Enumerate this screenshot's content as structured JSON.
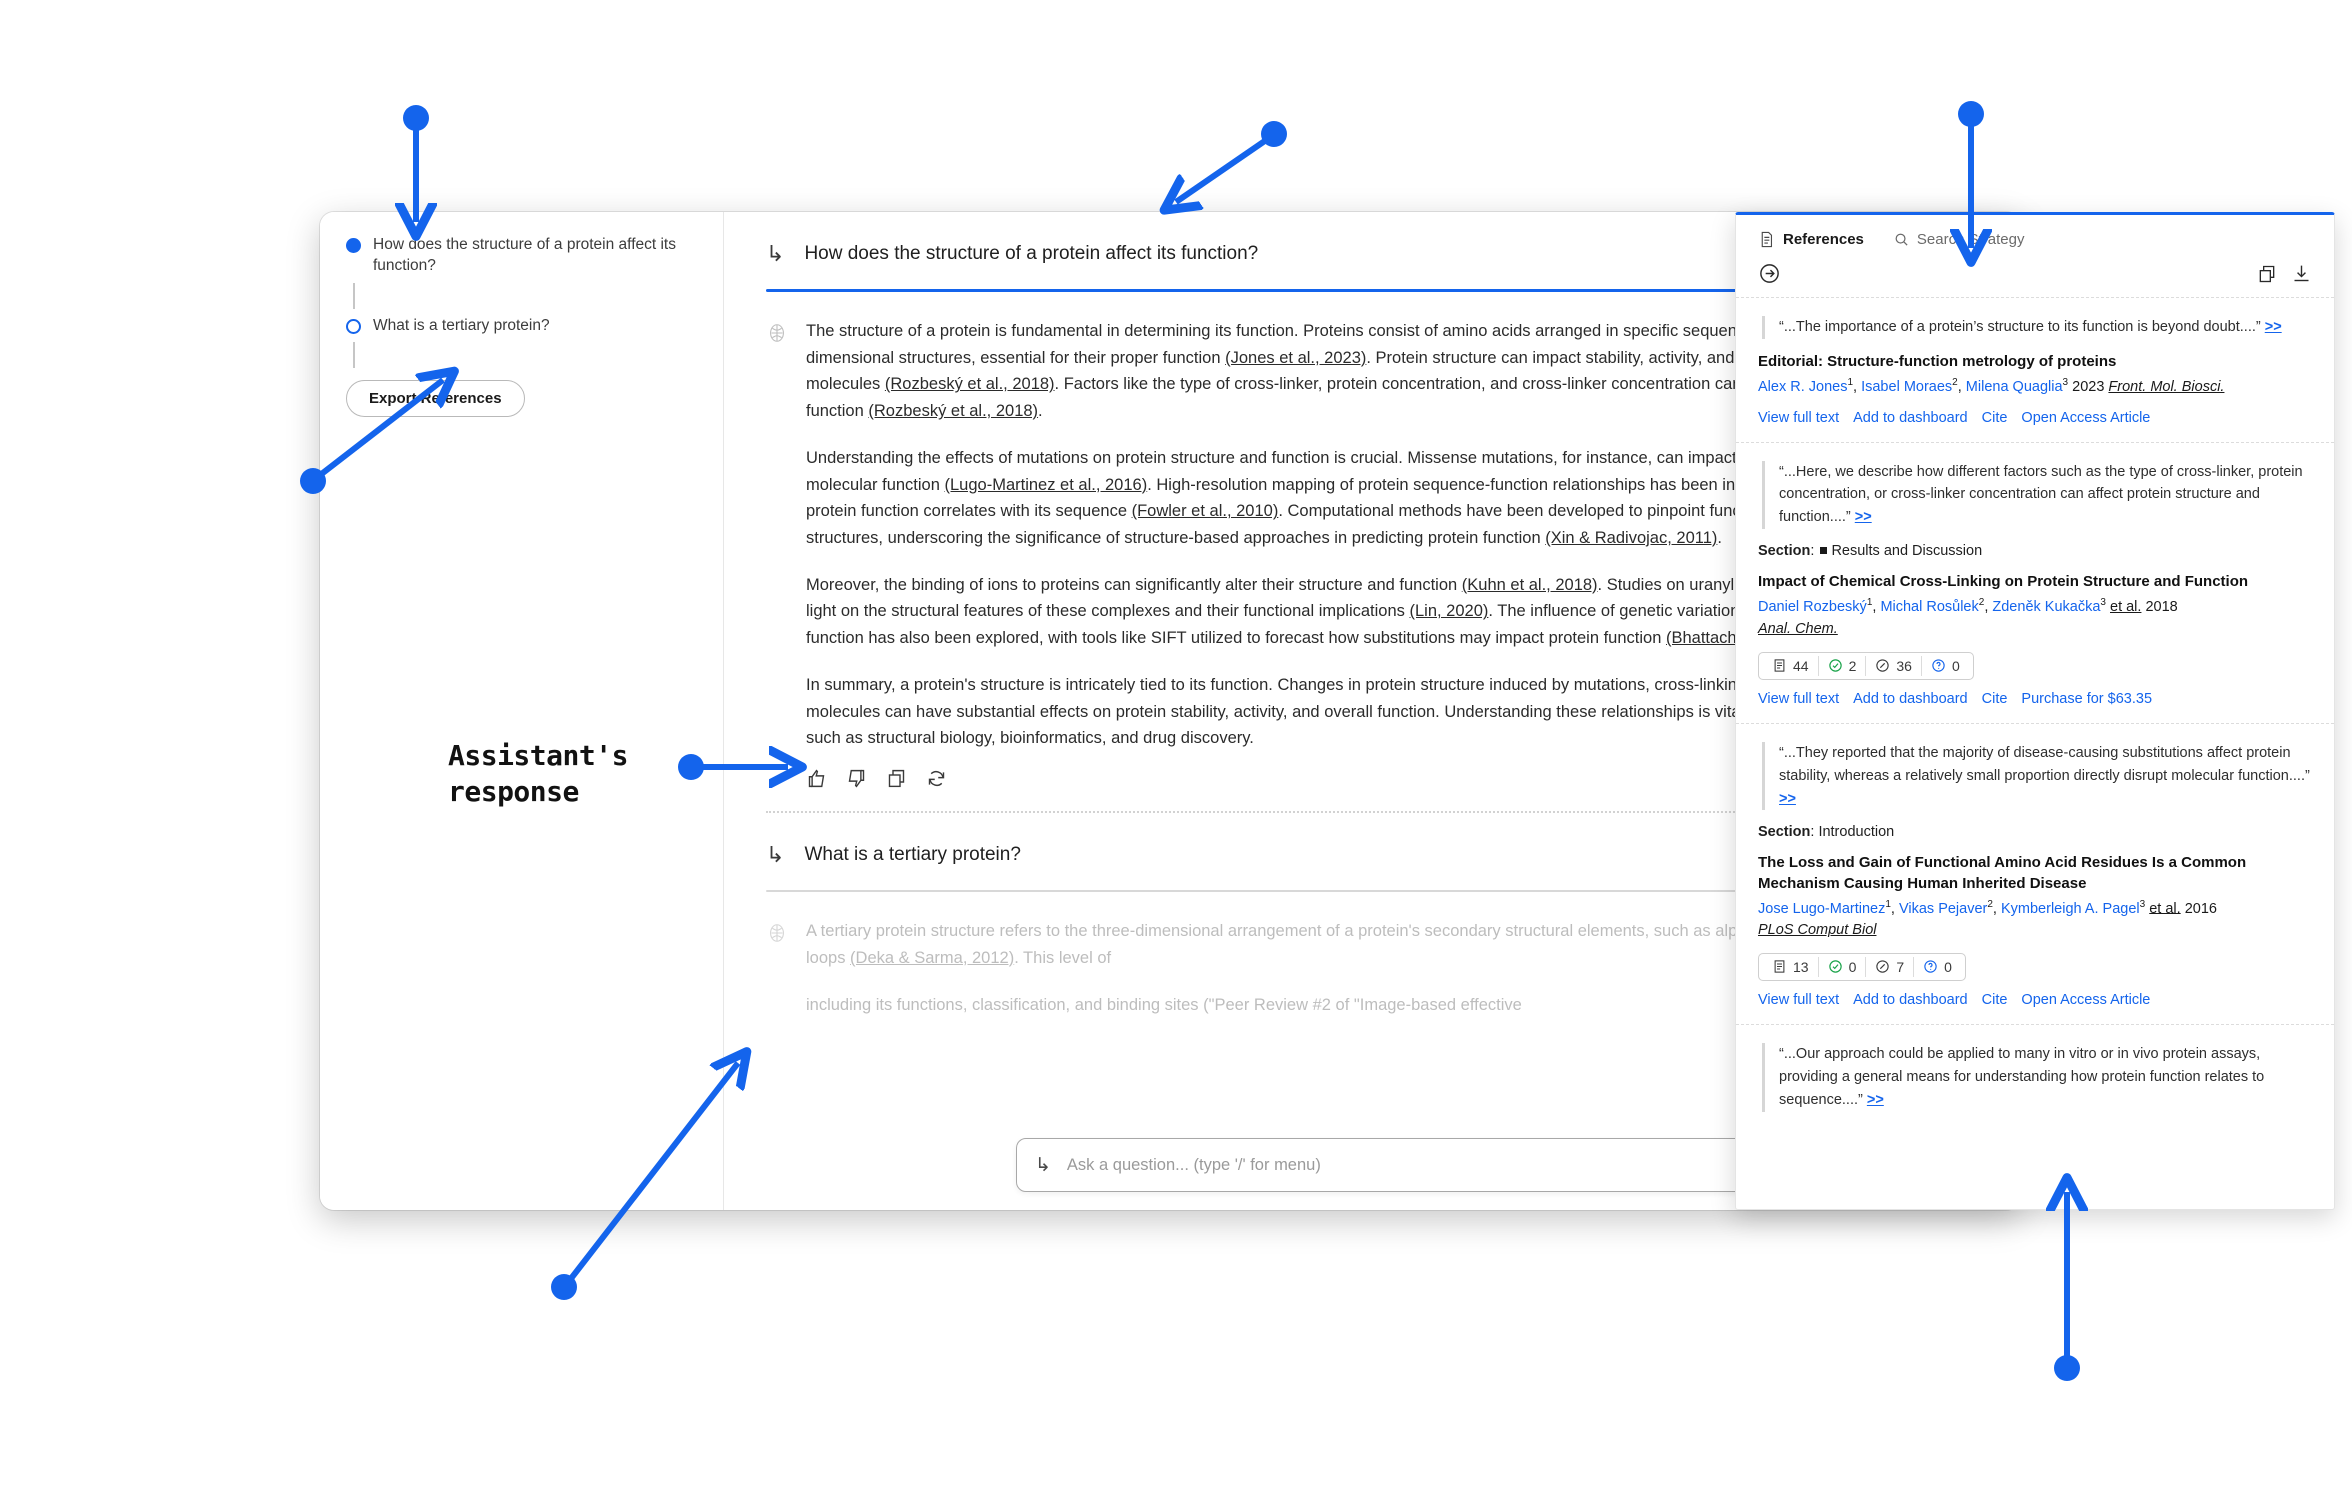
{
  "sidebar": {
    "outline": [
      {
        "label": "How does the structure of a protein affect its function?",
        "state": "active"
      },
      {
        "label": "What is a tertiary protein?",
        "state": "inactive"
      }
    ],
    "export_button": "Export References"
  },
  "conversation": {
    "turns": [
      {
        "question": "How does the structure of a protein affect its function?",
        "paragraphs": [
          "The structure of a protein is fundamental in determining its function. Proteins consist of amino acids arranged in specific sequences that fold into intricate three-dimensional structures, essential for their proper function (Jones et al., 2023). Protein structure can impact stability, activity, and interactions with other molecules (Rozbeský et al., 2018). Factors like the type of cross-linker, protein concentration, and cross-linker concentration can influence protein structure and function (Rozbeský et al., 2018).",
          "Understanding the effects of mutations on protein structure and function is crucial. Missense mutations, for instance, can impact protein stability and disrupt molecular function (Lugo-Martinez et al., 2016). High-resolution mapping of protein sequence-function relationships has been instrumental in revealing how protein function correlates with its sequence (Fowler et al., 2010). Computational methods have been developed to pinpoint functional residues in protein structures, underscoring the significance of structure-based approaches in predicting protein function (Xin & Radivojac, 2011).",
          "Moreover, the binding of ions to proteins can significantly alter their structure and function (Kuhn et al., 2018). Studies on uranyl-protein interactions have shed light on the structural features of these complexes and their functional implications (Lin, 2020). The influence of genetic variation on protein structure and function has also been explored, with tools like SIFT utilized to forecast how substitutions may impact protein function (Bhattacharya et al., 2017).",
          "In summary, a protein's structure is intricately tied to its function. Changes in protein structure induced by mutations, cross-linking, or interactions with other molecules can have substantial effects on protein stability, activity, and overall function. Understanding these relationships is vital for the advancement of fields such as structural biology, bioinformatics, and drug discovery."
        ],
        "feedback_icons": [
          "thumbs-up-icon",
          "thumbs-down-icon",
          "copy-icon",
          "regenerate-icon"
        ]
      },
      {
        "question": "What is a tertiary protein?",
        "paragraphs": [
          "A tertiary protein structure refers to the three-dimensional arrangement of a protein's secondary structural elements, such as alpha-helices, beta-sheets, and loops (Deka & Sarma, 2012). This level of",
          "including its functions, classification, and binding sites (\"Peer Review #2 of \"Image-based effective"
        ]
      }
    ]
  },
  "ask": {
    "placeholder": "Ask a question... (type '/' for menu)",
    "value": "",
    "send_icon": "send-icon"
  },
  "references_panel": {
    "tabs": [
      {
        "label": "References",
        "icon": "document-icon",
        "active": true
      },
      {
        "label": "Search Strategy",
        "icon": "search-icon",
        "active": false
      }
    ],
    "toolbar": {
      "expand_icon": "arrow-right-circle-icon",
      "copy_icon": "copy-icon",
      "download_icon": "download-icon"
    },
    "items": [
      {
        "quote": "“...The importance of a protein’s structure to its function is beyond doubt....”",
        "more": ">>",
        "section_label": "",
        "section_value": "",
        "title": "Editorial: Structure-function metrology of proteins",
        "authors": [
          {
            "name": "Alex R. Jones",
            "sup": "1"
          },
          {
            "name": "Isabel Moraes",
            "sup": "2"
          },
          {
            "name": "Milena Quaglia",
            "sup": "3"
          }
        ],
        "etal": "",
        "year": "2023",
        "journal": "Front. Mol. Biosci.",
        "metrics": [],
        "actions": [
          "View full text",
          "Add to dashboard",
          "Cite",
          "Open Access Article"
        ]
      },
      {
        "quote": "“...Here, we describe how different factors such as the type of cross-linker, protein concentration, or cross-linker concentration can affect protein structure and function....”",
        "more": ">>",
        "section_label": "Section",
        "section_value": "Results and Discussion",
        "title": "Impact of Chemical Cross-Linking on Protein Structure and Function",
        "authors": [
          {
            "name": "Daniel Rozbeský",
            "sup": "1"
          },
          {
            "name": "Michal Rosůlek",
            "sup": "2"
          },
          {
            "name": "Zdeněk Kukačka",
            "sup": "3"
          }
        ],
        "etal": "et al.",
        "year": "2018",
        "journal": "Anal. Chem.",
        "metrics": [
          {
            "icon": "document-icon",
            "value": "44",
            "color": "#3a3a3a"
          },
          {
            "icon": "check-circle-icon",
            "value": "2",
            "color": "#1aa34a"
          },
          {
            "icon": "slash-circle-icon",
            "value": "36",
            "color": "#3a3a3a"
          },
          {
            "icon": "question-circle-icon",
            "value": "0",
            "color": "#1464ec"
          }
        ],
        "actions": [
          "View full text",
          "Add to dashboard",
          "Cite",
          "Purchase for $63.35"
        ]
      },
      {
        "quote": "“...They reported that the majority of disease-causing substitutions affect protein stability, whereas a relatively small proportion directly disrupt molecular function....”",
        "more": ">>",
        "section_label": "Section",
        "section_value": "Introduction",
        "title": "The Loss and Gain of Functional Amino Acid Residues Is a Common Mechanism Causing Human Inherited Disease",
        "authors": [
          {
            "name": "Jose Lugo-Martinez",
            "sup": "1"
          },
          {
            "name": "Vikas Pejaver",
            "sup": "2"
          },
          {
            "name": "Kymberleigh A. Pagel",
            "sup": "3"
          }
        ],
        "etal": "et al.",
        "year": "2016",
        "journal": "PLoS Comput Biol",
        "metrics": [
          {
            "icon": "document-icon",
            "value": "13",
            "color": "#3a3a3a"
          },
          {
            "icon": "check-circle-icon",
            "value": "0",
            "color": "#1aa34a"
          },
          {
            "icon": "slash-circle-icon",
            "value": "7",
            "color": "#3a3a3a"
          },
          {
            "icon": "question-circle-icon",
            "value": "0",
            "color": "#1464ec"
          }
        ],
        "actions": [
          "View full text",
          "Add to dashboard",
          "Cite",
          "Open Access Article"
        ]
      },
      {
        "quote": "“...Our approach could be applied to many in vitro or in vivo protein assays, providing a general means for understanding how protein function relates to sequence....”",
        "more": ">>",
        "section_label": "",
        "section_value": "",
        "title": "",
        "authors": [],
        "etal": "",
        "year": "",
        "journal": "",
        "metrics": [],
        "actions": []
      }
    ]
  },
  "annotations": {
    "assistant_response": "Assistant's\nresponse",
    "accent_color": "#1464ec"
  }
}
